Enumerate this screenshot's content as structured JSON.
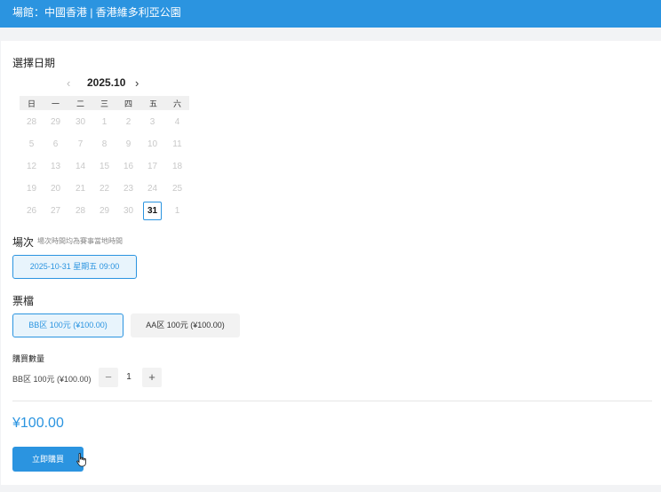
{
  "venue": {
    "text": "場館：中國香港 | 香港維多利亞公園"
  },
  "date_section": {
    "label": "選擇日期"
  },
  "calendar": {
    "month": "2025.10",
    "prev_icon": "chevron-left-icon",
    "next_icon": "chevron-right-icon",
    "weekdays": [
      "日",
      "一",
      "二",
      "三",
      "四",
      "五",
      "六"
    ],
    "weeks": [
      [
        "28",
        "29",
        "30",
        "1",
        "2",
        "3",
        "4"
      ],
      [
        "5",
        "6",
        "7",
        "8",
        "9",
        "10",
        "11"
      ],
      [
        "12",
        "13",
        "14",
        "15",
        "16",
        "17",
        "18"
      ],
      [
        "19",
        "20",
        "21",
        "22",
        "23",
        "24",
        "25"
      ],
      [
        "26",
        "27",
        "28",
        "29",
        "30",
        "31",
        "1"
      ]
    ],
    "selected_day": "31"
  },
  "session": {
    "label": "場次",
    "note": "場次時間均為賽事當地時間",
    "option": "2025-10-31 星期五 09:00"
  },
  "tickets": {
    "label": "票檔",
    "options": [
      "BB区 100元 (¥100.00)",
      "AA区 100元 (¥100.00)"
    ],
    "selected_index": 0
  },
  "quantity": {
    "label": "購買數量",
    "item": "BB区 100元 (¥100.00)",
    "minus": "−",
    "plus": "+",
    "value": "1"
  },
  "total": "¥100.00",
  "buy_button": "立即購買",
  "colors": {
    "accent": "#2b94e0",
    "selected_bg": "#e8f4fc"
  }
}
